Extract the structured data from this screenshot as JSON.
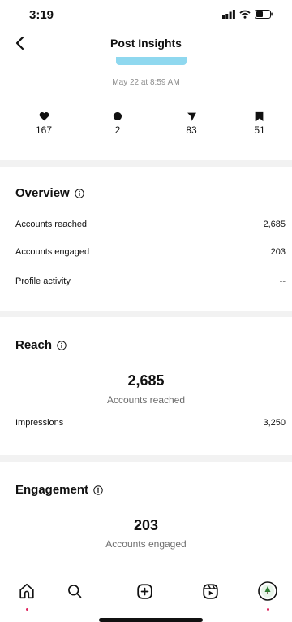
{
  "status": {
    "time": "3:19"
  },
  "nav": {
    "title": "Post Insights"
  },
  "post": {
    "date": "May 22 at 8:59 AM"
  },
  "stats": [
    {
      "icon": "heart-icon",
      "value": "167"
    },
    {
      "icon": "comment-icon",
      "value": "2"
    },
    {
      "icon": "share-icon",
      "value": "83"
    },
    {
      "icon": "bookmark-icon",
      "value": "51"
    }
  ],
  "overview": {
    "title": "Overview",
    "rows": [
      {
        "label": "Accounts reached",
        "value": "2,685"
      },
      {
        "label": "Accounts engaged",
        "value": "203"
      },
      {
        "label": "Profile activity",
        "value": "--"
      }
    ]
  },
  "reach": {
    "title": "Reach",
    "big_number": "2,685",
    "big_label": "Accounts reached",
    "impressions_label": "Impressions",
    "impressions_value": "3,250"
  },
  "engagement": {
    "title": "Engagement",
    "big_number": "203",
    "big_label": "Accounts engaged"
  },
  "tabs": [
    "home-icon",
    "search-icon",
    "create-icon",
    "reels-icon",
    "profile-avatar"
  ],
  "colors": {
    "notification_dot": "#e0245e",
    "thumbnail": "#8fd8ef",
    "divider": "#f2f2f2"
  }
}
